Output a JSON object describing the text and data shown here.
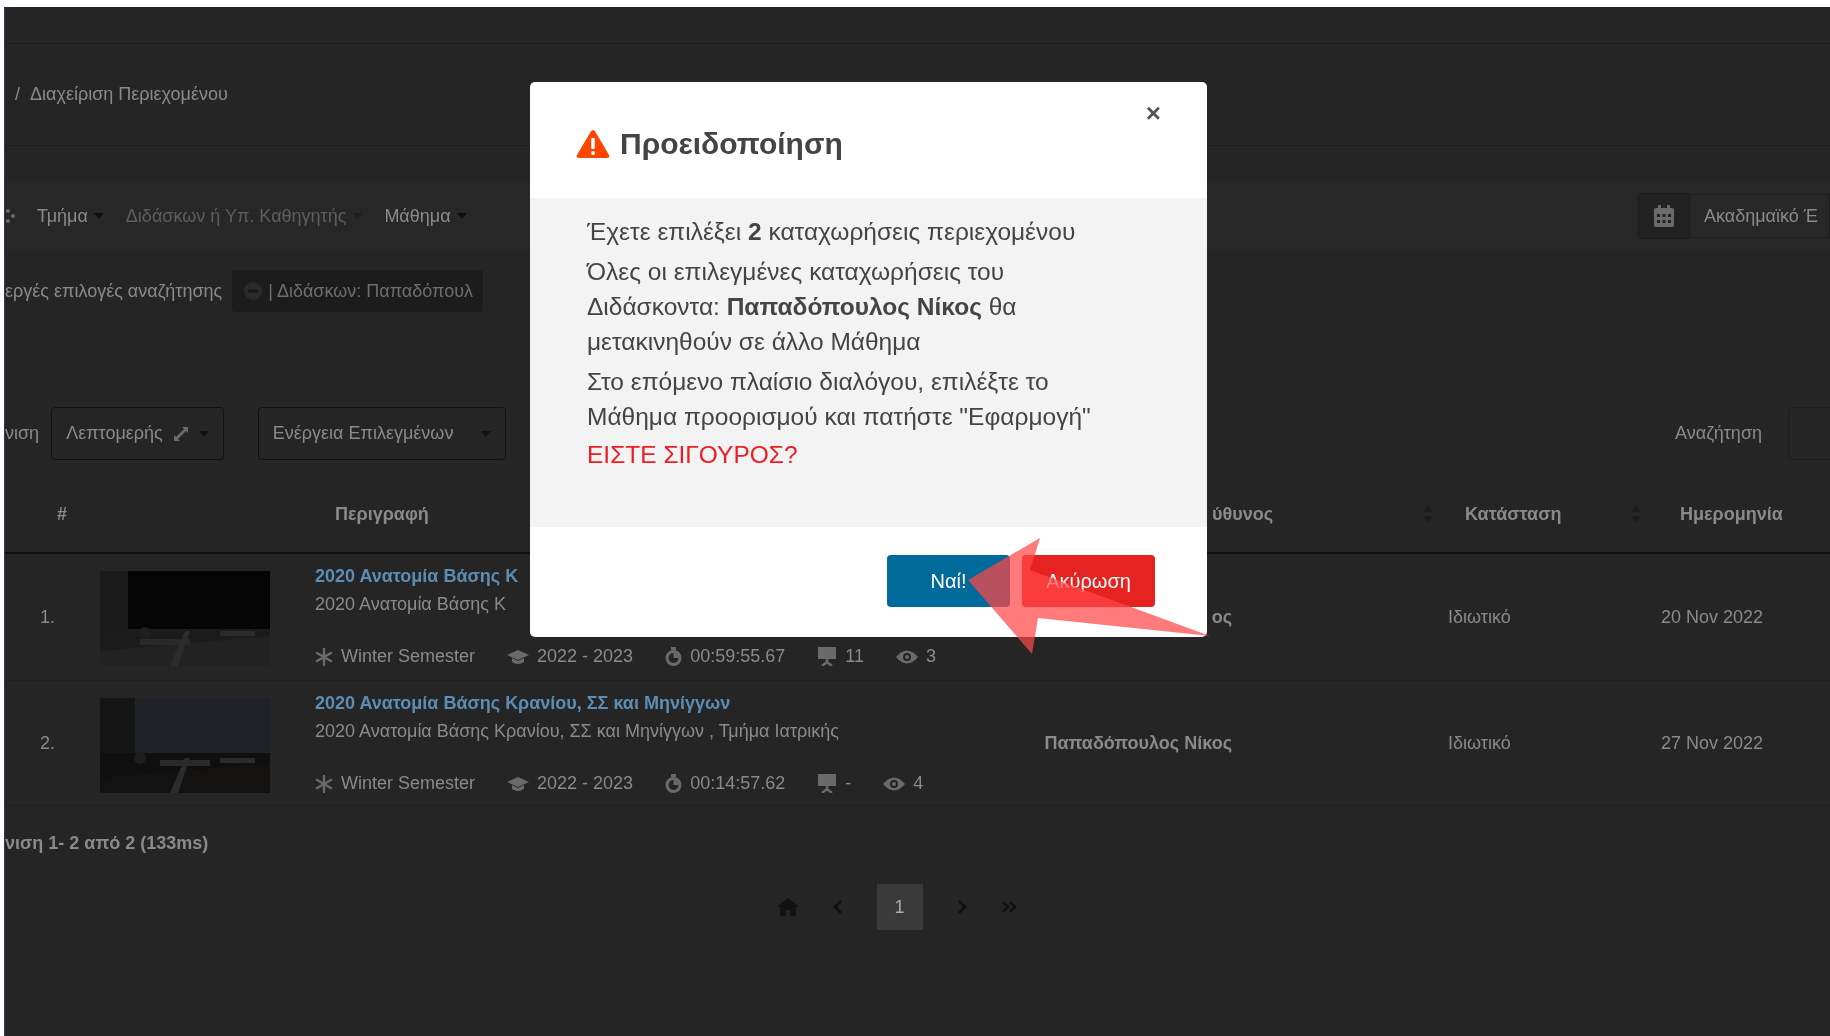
{
  "breadcrumb": {
    "separator": "/",
    "current": "Διαχείριση Περιεχομένου"
  },
  "filters": [
    {
      "label": "Τμήμα",
      "disabled": false
    },
    {
      "label": "Διδάσκων ή Υπ. Καθηγητής",
      "disabled": true
    },
    {
      "label": "Μάθημα",
      "disabled": false
    }
  ],
  "year_field": {
    "value": "Ακαδημαϊκό Έ"
  },
  "active_filters": {
    "label": "εργές επιλογές αναζήτησης",
    "chips": [
      "| Διδάσκων: Παπαδόπουλ"
    ]
  },
  "toolbar": {
    "view_label": "νιση",
    "view_button": "Λεπτομερής",
    "actions_button": "Ενέργεια Επιλεγμένων",
    "search_label": "Αναζήτηση"
  },
  "table": {
    "columns": [
      {
        "label": "#",
        "sortable": false
      },
      {
        "label": "Περιγραφή",
        "sortable": false
      },
      {
        "label": "ύθυνος",
        "sortable": true
      },
      {
        "label": "Κατάσταση",
        "sortable": true
      },
      {
        "label": "Ημερομηνία",
        "sortable": false
      }
    ],
    "rows": [
      {
        "number": "1.",
        "title": "2020 Ανατομία Βάσης Κ",
        "subtitle": "2020 Ανατομία Βάσης Κ",
        "semester": "Winter Semester",
        "year": "2022 - 2023",
        "duration": "00:59:55.67",
        "slides": "11",
        "views": "3",
        "owner": "ος",
        "status": "Ιδιωτικό",
        "date": "20 Nov 2022"
      },
      {
        "number": "2.",
        "title": "2020 Ανατομία Βάσης Κρανίου, ΣΣ και Μηνίγγων",
        "subtitle": "2020 Ανατομία Βάσης Κρανίου, ΣΣ και Μηνίγγων , Τμήμα Ιατρικής",
        "semester": "Winter Semester",
        "year": "2022 - 2023",
        "duration": "00:14:57.62",
        "slides": "-",
        "views": "4",
        "owner": "Παπαδόπουλος Νίκος",
        "status": "Ιδιωτικό",
        "date": "27 Nov 2022"
      }
    ]
  },
  "footer": "νιση 1- 2 από 2 (133ms)",
  "pagination": {
    "pages": [
      {
        "label": "1",
        "selected": true
      }
    ]
  },
  "dialog": {
    "title": "Προειδοποίηση",
    "close": "×",
    "paragraphs": [
      "Έχετε επιλέξει **2** καταχωρήσεις περιεχομένου",
      "Όλες οι επιλεγμένες καταχωρήσεις του Διδάσκοντα: **Παπαδόπουλος Νίκος** θα μετακινηθούν σε άλλο Μάθημα",
      "Στο επόμενο πλαίσιο διαλόγου, επιλέξτε το Μάθημα προορισμού και πατήστε \"Εφαρμογή\""
    ],
    "warning": "ΕΙΣΤΕ ΣΙΓΟΥΡΟΣ?",
    "buttons": [
      {
        "label": "Ναί!",
        "kind": "confirm"
      },
      {
        "label": "Ακύρωση",
        "kind": "cancel"
      }
    ]
  }
}
